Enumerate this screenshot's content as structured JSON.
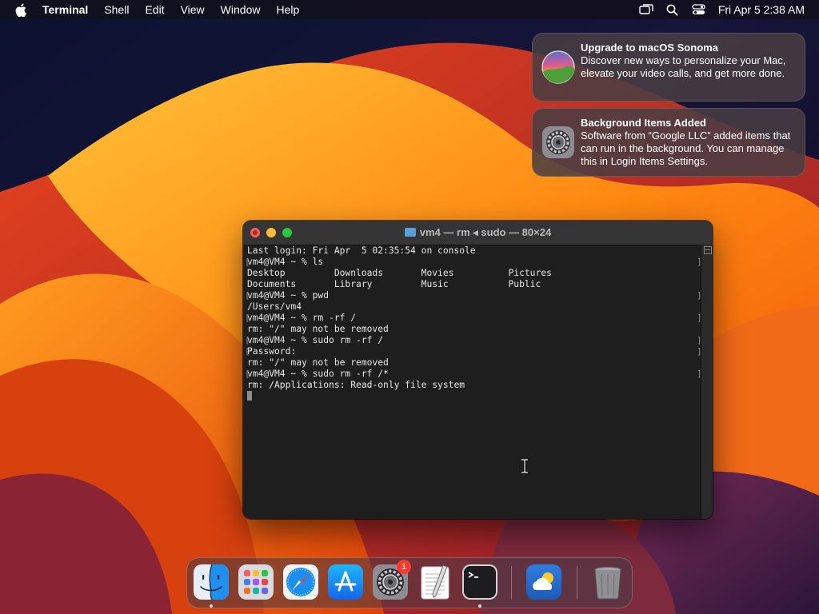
{
  "menubar": {
    "app_name": "Terminal",
    "items": [
      "Shell",
      "Edit",
      "View",
      "Window",
      "Help"
    ],
    "clock": "Fri Apr 5  2:38 AM",
    "status_icons": [
      "screen-mirroring-icon",
      "spotlight-search-icon",
      "control-center-icon"
    ]
  },
  "notifications": [
    {
      "title": "Upgrade to macOS Sonoma",
      "body": "Discover new ways to personalize your Mac, elevate your video calls, and get more done.",
      "icon": "macos-sonoma-icon"
    },
    {
      "title": "Background Items Added",
      "body": "Software from “Google LLC” added items that can run in the background. You can manage this in Login Items Settings.",
      "icon": "system-settings-icon"
    }
  ],
  "terminal": {
    "title": "vm4 — rm ◂ sudo — 80×24",
    "lines": [
      {
        "text": "Last login: Fri Apr  5 02:35:54 on console",
        "mark": false
      },
      {
        "text": "vm4@VM4 ~ % ls",
        "mark": true
      },
      {
        "text": "Desktop         Downloads       Movies          Pictures",
        "mark": false
      },
      {
        "text": "Documents       Library         Music           Public",
        "mark": false
      },
      {
        "text": "vm4@VM4 ~ % pwd",
        "mark": true
      },
      {
        "text": "/Users/vm4",
        "mark": false
      },
      {
        "text": "vm4@VM4 ~ % rm -rf /",
        "mark": true
      },
      {
        "text": "rm: \"/\" may not be removed",
        "mark": false
      },
      {
        "text": "vm4@VM4 ~ % sudo rm -rf /",
        "mark": true
      },
      {
        "text": "Password:",
        "mark": true
      },
      {
        "text": "rm: \"/\" may not be removed",
        "mark": false
      },
      {
        "text": "vm4@VM4 ~ % sudo rm -rf /*",
        "mark": true
      },
      {
        "text": "rm: /Applications: Read-only file system",
        "mark": false
      }
    ]
  },
  "dock": {
    "apps": [
      {
        "name": "Finder",
        "icon": "finder-icon",
        "running": true
      },
      {
        "name": "Launchpad",
        "icon": "launchpad-icon",
        "running": false
      },
      {
        "name": "Safari",
        "icon": "safari-icon",
        "running": false
      },
      {
        "name": "App Store",
        "icon": "app-store-icon",
        "running": false
      },
      {
        "name": "System Settings",
        "icon": "system-settings-icon",
        "running": false,
        "badge": "1"
      },
      {
        "name": "TextEdit",
        "icon": "textedit-icon",
        "running": false
      },
      {
        "name": "Terminal",
        "icon": "terminal-icon",
        "running": true
      },
      {
        "name": "Weather",
        "icon": "weather-icon",
        "running": false
      },
      {
        "name": "Trash",
        "icon": "trash-icon",
        "running": false
      }
    ]
  },
  "colors": {
    "close": "#ff5f57",
    "minimize": "#febc2e",
    "zoom": "#28c840",
    "badge": "#ff3b30"
  }
}
